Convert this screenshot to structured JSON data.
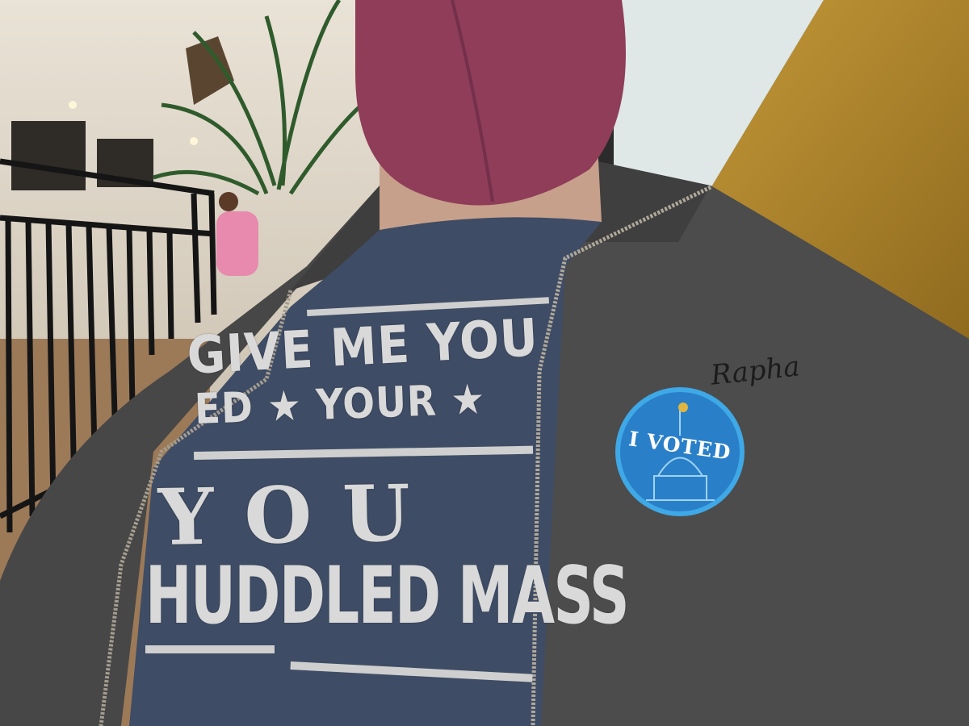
{
  "photo": {
    "shirt": {
      "line1": "GIVE ME YOU",
      "line2": "ED ★ YOUR ★",
      "line3": "YOU",
      "line4": "HUDDLED MASS"
    },
    "sticker": {
      "label": "I VOTED",
      "color": "#2a7fc9",
      "ring_color": "#3fa8e6"
    },
    "jacket_brand": "Rapha",
    "colors": {
      "mask": "#8f3d58",
      "jacket": "#4a4a4a",
      "shirt": "#3e4b63",
      "wall_gold": "#b8892c"
    }
  }
}
